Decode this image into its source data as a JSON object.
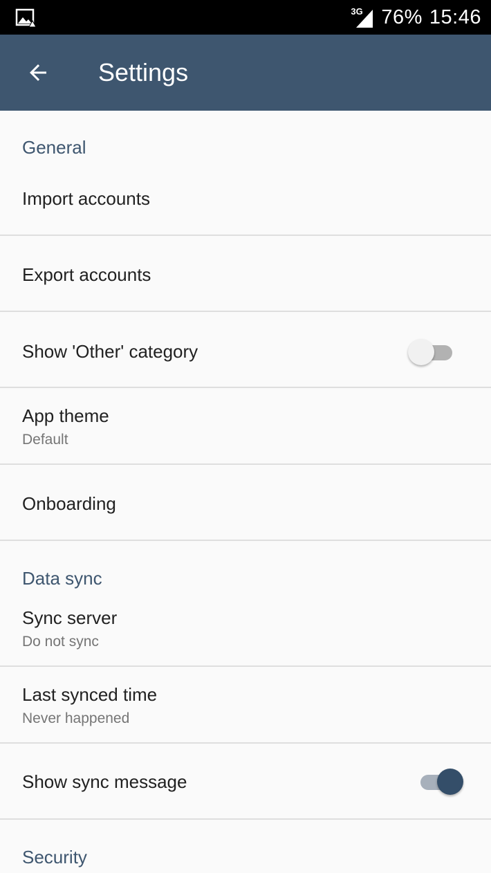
{
  "status_bar": {
    "network": "3G",
    "battery": "76%",
    "time": "15:46"
  },
  "app_bar": {
    "title": "Settings",
    "back_icon": "arrow-back-icon"
  },
  "sections": {
    "general": {
      "header": "General",
      "import_accounts": "Import accounts",
      "export_accounts": "Export accounts",
      "show_other_category": {
        "title": "Show 'Other' category",
        "enabled": false
      },
      "app_theme": {
        "title": "App theme",
        "summary": "Default"
      },
      "onboarding": "Onboarding"
    },
    "data_sync": {
      "header": "Data sync",
      "sync_server": {
        "title": "Sync server",
        "summary": "Do not sync"
      },
      "last_synced_time": {
        "title": "Last synced time",
        "summary": "Never happened"
      },
      "show_sync_message": {
        "title": "Show sync message",
        "enabled": true
      }
    },
    "security": {
      "header": "Security"
    }
  },
  "colors": {
    "app_bar": "#3e566f",
    "accent": "#344e69",
    "section_header": "#3e566f"
  }
}
